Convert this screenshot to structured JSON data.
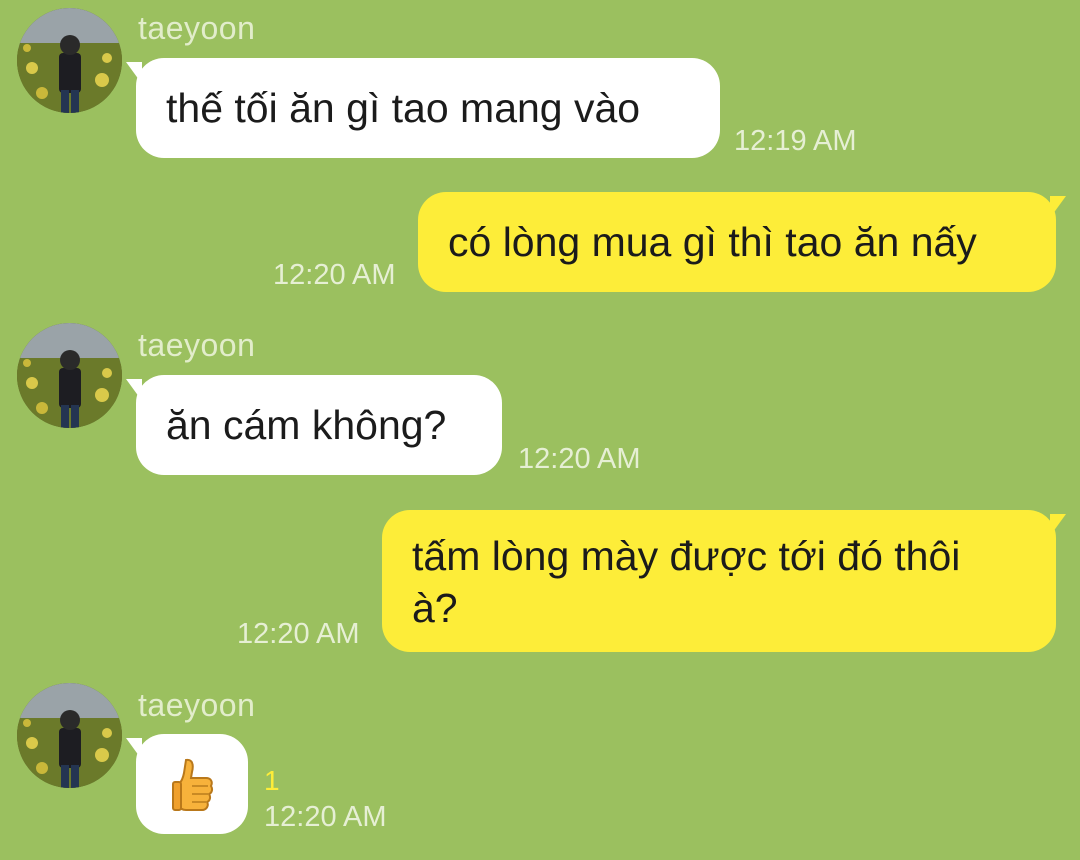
{
  "colors": {
    "background": "#9bc05f",
    "incoming_bubble": "#ffffff",
    "outgoing_bubble": "#fded39",
    "timestamp": "#e6efd4",
    "unread_count": "#fded39"
  },
  "messages": [
    {
      "direction": "incoming",
      "sender": "taeyoon",
      "text": "thế tối ăn gì tao mang vào",
      "time": "12:19 AM"
    },
    {
      "direction": "outgoing",
      "text": "có lòng mua gì thì tao ăn nấy",
      "time": "12:20 AM"
    },
    {
      "direction": "incoming",
      "sender": "taeyoon",
      "text": "ăn cám không?",
      "time": "12:20 AM"
    },
    {
      "direction": "outgoing",
      "text_line1": "tấm lòng mày được tới đó thôi",
      "text_line2": "à?",
      "time": "12:20 AM"
    },
    {
      "direction": "incoming",
      "sender": "taeyoon",
      "emoji": "thumbs-up-icon",
      "unread_count": "1",
      "time": "12:20 AM"
    }
  ]
}
